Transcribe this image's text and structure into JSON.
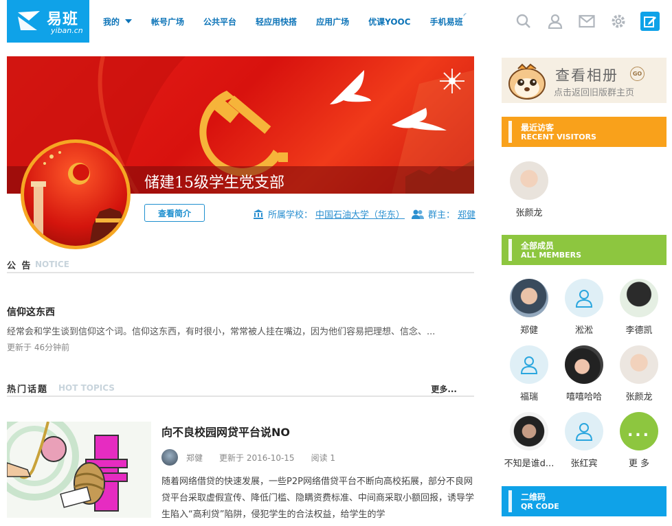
{
  "header": {
    "logo_cn": "易班",
    "logo_en": "yiban.cn",
    "nav": [
      {
        "label": "我的"
      },
      {
        "label": "帐号广场"
      },
      {
        "label": "公共平台"
      },
      {
        "label": "轻应用快搭"
      },
      {
        "label": "应用广场"
      },
      {
        "label": "优课YOOC"
      },
      {
        "label": "手机易班"
      }
    ],
    "tools": [
      "search-icon",
      "user-icon",
      "mail-icon",
      "gear-icon",
      "edit-icon"
    ]
  },
  "group": {
    "title": "储建15级学生党支部",
    "intro_button": "查看简介",
    "school_label": "所属学校：",
    "school_name": "中国石油大学（华东）",
    "owner_label": "群主：",
    "owner_name": "郑健"
  },
  "notice": {
    "heading_cn": "公 告",
    "heading_en": "NOTICE",
    "title": "信仰这东西",
    "excerpt": "经常会和学生谈到信仰这个词。信仰这东西，有时很小，常常被人挂在嘴边，因为他们容易把理想、信念、...",
    "updated": "更新于  46分钟前"
  },
  "topics": {
    "heading_cn": "热门话题",
    "heading_en": "HOT TOPICS",
    "more": "更多...",
    "item": {
      "title": "向不良校园网贷平台说NO",
      "author": "郑健",
      "updated": "更新于  2016-10-15",
      "reads": "阅读  1",
      "body": "随着网络借贷的快速发展，一些P2P网络借贷平台不断向高校拓展，部分不良网贷平台采取虚假宣传、降低门槛、隐瞒资费标准、中间商采取小额回报，诱导学生陷入“高利贷”陷阱，侵犯学生的合法权益，给学生的学"
    }
  },
  "sidebar": {
    "album_title": "查看相册",
    "album_go": "GO",
    "album_sub": "点击返回旧版群主页",
    "visitors_cn": "最近访客",
    "visitors_en": "RECENT VISITORS",
    "visitors": [
      {
        "name": "张颜龙"
      }
    ],
    "members_cn": "全部成员",
    "members_en": "ALL MEMBERS",
    "members": [
      {
        "name": "郑健"
      },
      {
        "name": "淞淞"
      },
      {
        "name": "李德凯"
      },
      {
        "name": "福瑞"
      },
      {
        "name": "嘻嘻哈哈"
      },
      {
        "name": "张颜龙"
      },
      {
        "name": "不知是谁d..."
      },
      {
        "name": "张红宾"
      },
      {
        "name": "更 多"
      }
    ],
    "more_dots": "...",
    "qrcode_cn": "二维码",
    "qrcode_en": "QR CODE"
  },
  "colors": {
    "brand_blue": "#0fa2e8",
    "orange": "#f9a11b",
    "green": "#8dc63f",
    "banner_red": "#e8201a"
  }
}
